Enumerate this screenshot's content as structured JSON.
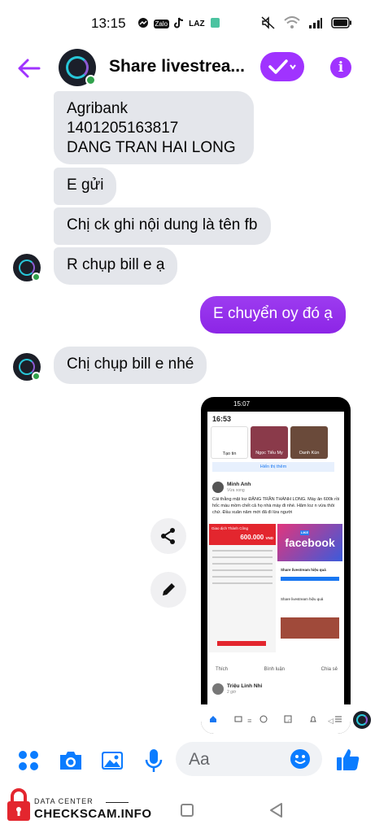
{
  "status_bar": {
    "time": "13:15",
    "apps": [
      "Zalo",
      "LAZ"
    ]
  },
  "header": {
    "title": "Share livestrea...",
    "info_glyph": "i"
  },
  "messages": [
    {
      "sender": "them",
      "text_lines": [
        "Agribank",
        "1401205163817",
        "DANG TRAN HAI LONG"
      ]
    },
    {
      "sender": "them",
      "text": "E gửi"
    },
    {
      "sender": "them",
      "text": "Chị ck ghi nội dung là tên fb"
    },
    {
      "sender": "them",
      "text": "R chụp bill e ạ"
    },
    {
      "sender": "me",
      "text": "E chuyển oy đó ạ"
    },
    {
      "sender": "them",
      "text": "Chị chụp bill e nhé"
    }
  ],
  "screenshot": {
    "status_time": "15:07",
    "time": "16:53",
    "stories": [
      "Tạo tin",
      "Ngọc Tiểu My",
      "Oanh Kún"
    ],
    "show_more": "Hiển thị thêm",
    "post_author": "Minh Anh",
    "post_time": "Vừa xong",
    "post_text": "Cái thằng mặt loz ĐẶNG TRẦN THÀNH LONG. Mày ăn 600k rồi hốc máu mồm chết cả họ nhà mày đi nhé. Hãm loz n vừa thôi chứ. Đầu xuân năm mới đã đi lừa người",
    "receipt_title": "Giao dịch Thành Công",
    "receipt_amount": "600.000",
    "receipt_currency": "VND",
    "fb_logo": "facebook",
    "fb_badge": "LIKE",
    "group_name": "Share livestream hiệu quả",
    "like_label": "Thích",
    "comment_label": "Bình luận",
    "share_label": "Chia sẻ",
    "next_author": "Triệu Linh Nhi",
    "next_time": "2 giờ"
  },
  "composer": {
    "placeholder": "Aa"
  },
  "watermark": {
    "line1": "DATA CENTER",
    "line2": "CHECKSCAM.INFO"
  },
  "colors": {
    "accent": "#a033ff",
    "bubble_other": "#e4e6eb",
    "blue_icon": "#0a7cff"
  }
}
